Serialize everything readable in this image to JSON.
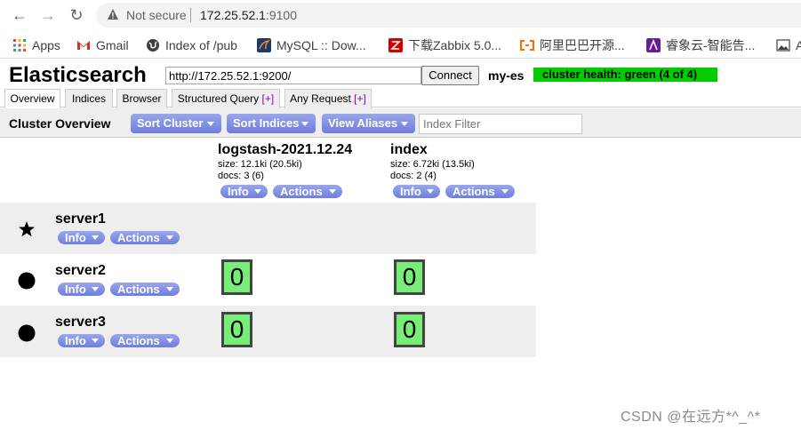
{
  "browser": {
    "address": {
      "security_label": "Not secure",
      "host": "172.25.52.1",
      "port": ":9100"
    },
    "bookmarks": [
      {
        "label": "Apps",
        "icon": "apps-grid-icon"
      },
      {
        "label": "Gmail",
        "icon": "gmail-icon"
      },
      {
        "label": "Index of /pub",
        "icon": "globe-icon"
      },
      {
        "label": "MySQL :: Dow...",
        "icon": "mysql-icon"
      },
      {
        "label": "下载Zabbix 5.0...",
        "icon": "zabbix-icon"
      },
      {
        "label": "阿里巴巴开源...",
        "icon": "aliyun-icon"
      },
      {
        "label": "睿象云-智能告...",
        "icon": "ruixiang-icon"
      },
      {
        "label": "A",
        "icon": "image-icon"
      }
    ]
  },
  "app": {
    "title": "Elasticsearch",
    "connect_url": "http://172.25.52.1:9200/",
    "connect_label": "Connect",
    "cluster_name": "my-es",
    "health": "cluster health: green (4 of 4)",
    "health_color": "#00cc00"
  },
  "tabs": [
    {
      "label": "Overview",
      "plus": ""
    },
    {
      "label": "Indices",
      "plus": ""
    },
    {
      "label": "Browser",
      "plus": ""
    },
    {
      "label": "Structured Query ",
      "plus": "[+]"
    },
    {
      "label": "Any Request ",
      "plus": "[+]"
    }
  ],
  "toolbar": {
    "title": "Cluster Overview",
    "sort_cluster": "Sort Cluster",
    "sort_indices": "Sort Indices",
    "view_aliases": "View Aliases",
    "filter_placeholder": "Index Filter"
  },
  "indices": [
    {
      "name": "logstash-2021.12.24",
      "size": "size: 12.1ki (20.5ki)",
      "docs": "docs: 3 (6)",
      "info": "Info",
      "actions": "Actions"
    },
    {
      "name": "index",
      "size": "size: 6.72ki (13.5ki)",
      "docs": "docs: 2 (4)",
      "info": "Info",
      "actions": "Actions"
    }
  ],
  "servers": [
    {
      "name": "server1",
      "master": true,
      "info": "Info",
      "actions": "Actions",
      "shards": [
        "",
        ""
      ]
    },
    {
      "name": "server2",
      "master": false,
      "info": "Info",
      "actions": "Actions",
      "shards": [
        "0",
        "0"
      ]
    },
    {
      "name": "server3",
      "master": false,
      "info": "Info",
      "actions": "Actions",
      "shards": [
        "0",
        "0"
      ]
    }
  ],
  "watermark": "CSDN @在远方*^_^*"
}
